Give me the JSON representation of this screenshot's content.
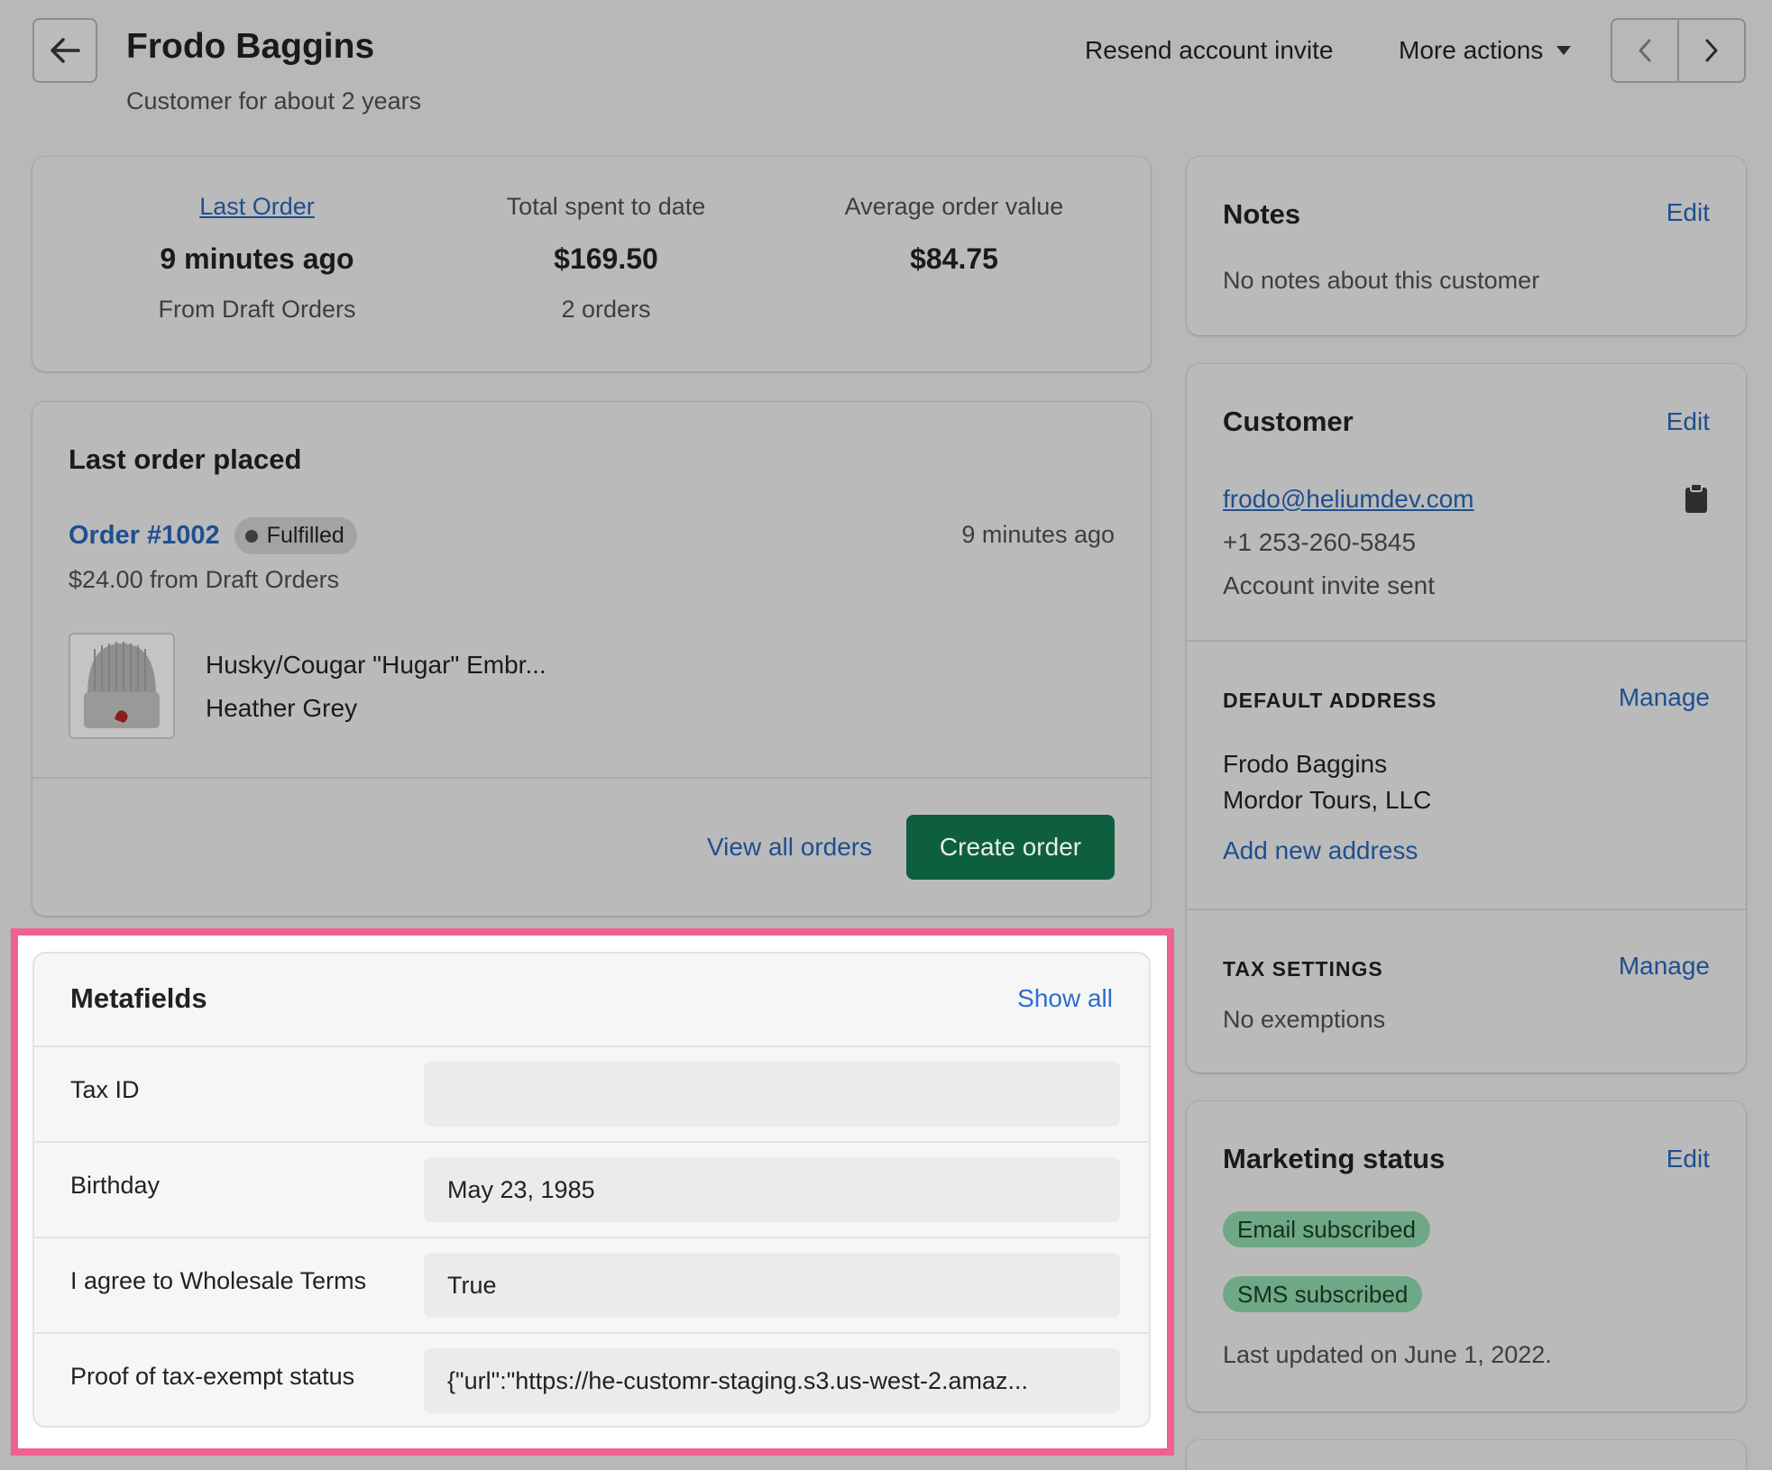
{
  "header": {
    "title": "Frodo Baggins",
    "subtitle": "Customer for about 2 years",
    "resend_label": "Resend account invite",
    "more_actions_label": "More actions"
  },
  "stats": {
    "last_order_label": "Last Order",
    "last_order_value": "9 minutes ago",
    "last_order_sub": "From Draft Orders",
    "total_spent_label": "Total spent to date",
    "total_spent_value": "$169.50",
    "total_spent_sub": "2 orders",
    "avg_label": "Average order value",
    "avg_value": "$84.75"
  },
  "last_order": {
    "title": "Last order placed",
    "order_number": "Order #1002",
    "status": "Fulfilled",
    "time": "9 minutes ago",
    "amount": "$24.00 from Draft Orders",
    "product_name": "Husky/Cougar \"Hugar\" Embr...",
    "product_variant": "Heather Grey",
    "view_all_label": "View all orders",
    "create_label": "Create order"
  },
  "metafields": {
    "title": "Metafields",
    "show_all_label": "Show all",
    "rows": [
      {
        "label": "Tax ID",
        "value": ""
      },
      {
        "label": "Birthday",
        "value": "May 23, 1985"
      },
      {
        "label": "I agree to Wholesale Terms",
        "value": "True"
      },
      {
        "label": "Proof of tax-exempt status",
        "value": "{\"url\":\"https://he-customr-staging.s3.us-west-2.amaz..."
      }
    ]
  },
  "notes": {
    "title": "Notes",
    "edit_label": "Edit",
    "text": "No notes about this customer"
  },
  "customer": {
    "title": "Customer",
    "edit_label": "Edit",
    "email": "frodo@heliumdev.com",
    "phone": "+1 253-260-5845",
    "invite_status": "Account invite sent",
    "default_address_label": "DEFAULT ADDRESS",
    "manage_label": "Manage",
    "address_name": "Frodo Baggins",
    "address_company": "Mordor Tours, LLC",
    "add_address_label": "Add new address",
    "tax_settings_label": "TAX SETTINGS",
    "tax_manage_label": "Manage",
    "tax_text": "No exemptions"
  },
  "marketing": {
    "title": "Marketing status",
    "edit_label": "Edit",
    "email_badge": "Email subscribed",
    "sms_badge": "SMS subscribed",
    "updated": "Last updated on June 1, 2022."
  },
  "colors": {
    "accent_link": "#1f4f8f",
    "primary_button": "#0e5e40",
    "highlight_border": "#f0628e",
    "subscribed_badge": "#6fa886"
  }
}
